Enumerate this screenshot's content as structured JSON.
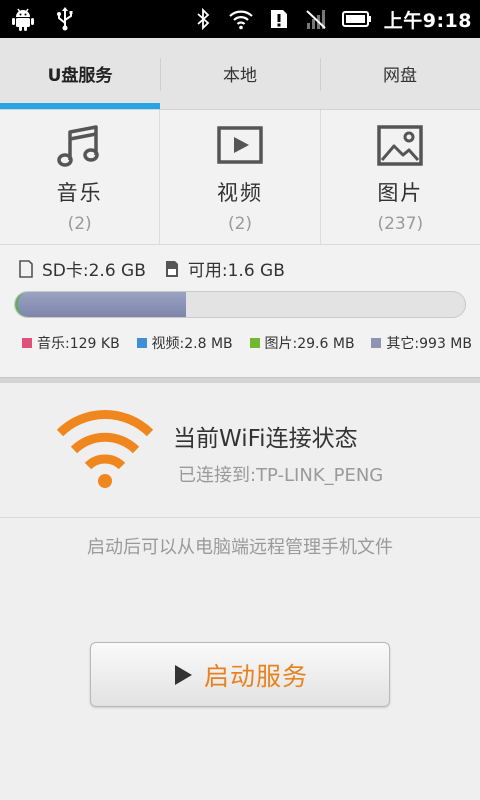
{
  "status_bar": {
    "time": "上午9:18",
    "left_icons": [
      "android-icon",
      "usb-icon"
    ],
    "right_icons": [
      "bluetooth-icon",
      "wifi-icon",
      "sd-alert-icon",
      "no-signal-icon",
      "battery-icon"
    ]
  },
  "tabs": [
    {
      "label": "U盘服务",
      "active": true
    },
    {
      "label": "本地",
      "active": false
    },
    {
      "label": "网盘",
      "active": false
    }
  ],
  "media": {
    "music": {
      "label": "音乐",
      "count": "(2)",
      "icon": "music-note-icon"
    },
    "video": {
      "label": "视频",
      "count": "(2)",
      "icon": "video-play-icon"
    },
    "pictures": {
      "label": "图片",
      "count": "(237)",
      "icon": "picture-icon"
    }
  },
  "storage": {
    "sd_total": "SD卡:2.6 GB",
    "available": "可用:1.6 GB",
    "used_fraction": 0.38,
    "legend": [
      {
        "label": "音乐:129 KB",
        "color": "#e0517a"
      },
      {
        "label": "视频:2.8 MB",
        "color": "#3f8fd6"
      },
      {
        "label": "图片:29.6 MB",
        "color": "#6fb82f"
      },
      {
        "label": "其它:993 MB",
        "color": "#8d95b3"
      }
    ]
  },
  "wifi": {
    "title": "当前WiFi连接状态",
    "connected": "已连接到:TP-LINK_PENG",
    "icon_color": "#f0861e"
  },
  "hint": "启动后可以从电脑端远程管理手机文件",
  "start_button": {
    "label": "启动服务",
    "accent": "#e8821e"
  }
}
